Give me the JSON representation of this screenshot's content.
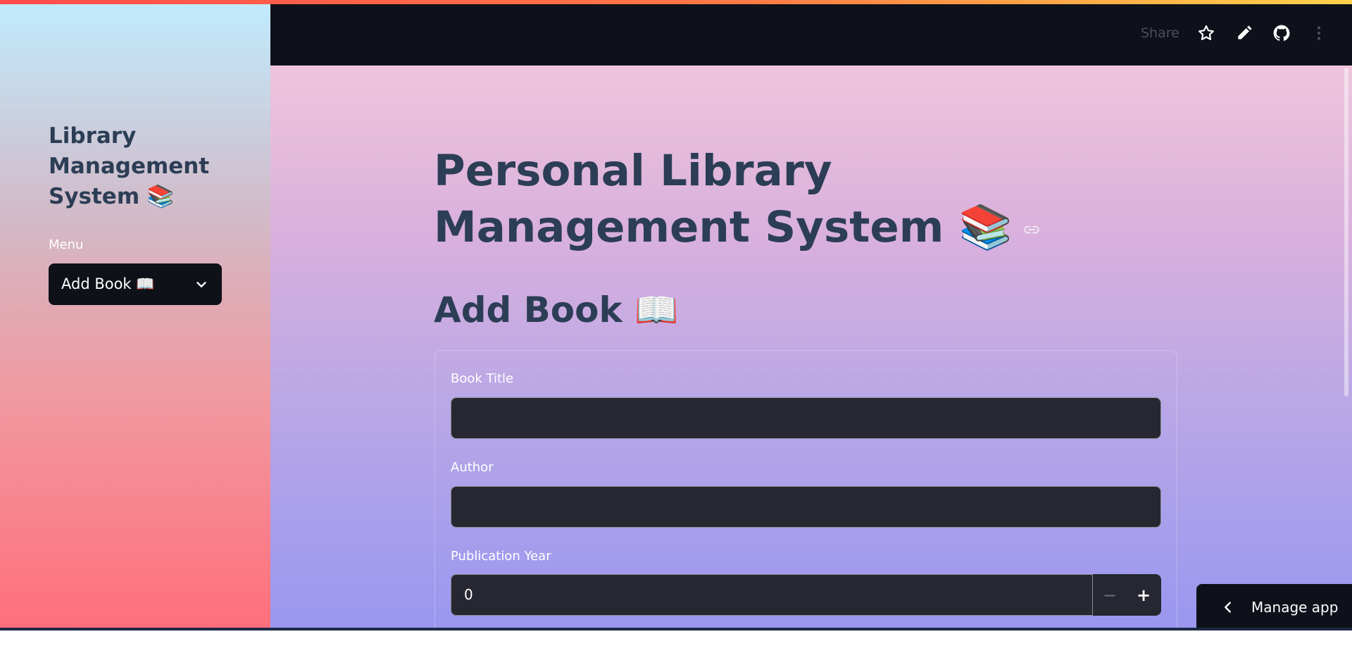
{
  "colors": {
    "accent_line": "#ff4b4b",
    "header_bg": "#0e111a",
    "heading_text": "#2c3e55",
    "input_bg": "#262730"
  },
  "header": {
    "share_label": "Share",
    "icons": [
      "star-icon",
      "pencil-icon",
      "github-icon",
      "more-vert-icon"
    ]
  },
  "sidebar": {
    "title": "Library Management System 📚",
    "menu_label": "Menu",
    "menu_selected": "Add Book 📖"
  },
  "main": {
    "title": "Personal Library Management System 📚",
    "section_title": "Add Book 📖",
    "form": {
      "title_label": "Book Title",
      "title_value": "",
      "author_label": "Author",
      "author_value": "",
      "year_label": "Publication Year",
      "year_value": "0",
      "minus_label": "−",
      "plus_label": "+"
    }
  },
  "manage_app": {
    "label": "Manage app"
  }
}
